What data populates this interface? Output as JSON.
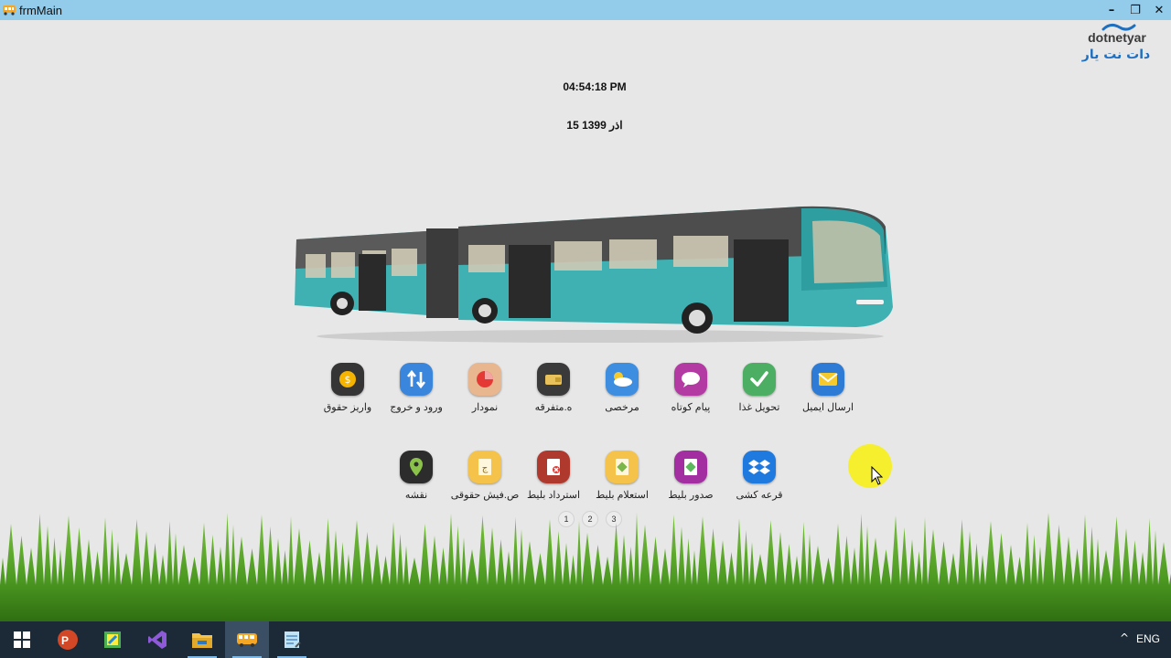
{
  "window": {
    "title": "frmMain",
    "minimize": "–",
    "restore": "❐",
    "close": "✕"
  },
  "brand": {
    "latin": "dotnetyar",
    "persian": "دات نت یار"
  },
  "clock": "04:54:18 PM",
  "date": "15 اذر 1399",
  "row1": [
    {
      "label": "ارسال ایمیل",
      "icon": "email-icon"
    },
    {
      "label": "تحویل غذا",
      "icon": "check-icon"
    },
    {
      "label": "پیام کوتاه",
      "icon": "message-icon"
    },
    {
      "label": "مرخصی",
      "icon": "weather-cloud-icon"
    },
    {
      "label": "ه.متفرقه",
      "icon": "wallet-icon"
    },
    {
      "label": "نمودار",
      "icon": "pie-chart-icon"
    },
    {
      "label": "ورود و خروج",
      "icon": "arrows-updown-icon"
    },
    {
      "label": "واریز حقوق",
      "icon": "coin-icon"
    }
  ],
  "row2": [
    {
      "label": "قرعه کشی",
      "icon": "dropbox-icon"
    },
    {
      "label": "صدور بلیط",
      "icon": "ticket-issue-icon"
    },
    {
      "label": "استعلام بلیط",
      "icon": "ticket-inquiry-icon"
    },
    {
      "label": "استرداد بلیط",
      "icon": "ticket-refund-icon"
    },
    {
      "label": "ص.فیش حقوقی",
      "icon": "payslip-icon"
    },
    {
      "label": "نقشه",
      "icon": "map-pin-icon"
    }
  ],
  "pager": [
    "1",
    "2",
    "3"
  ],
  "taskbar": {
    "apps": [
      "start-icon",
      "powerpoint-icon",
      "paint-icon",
      "visual-studio-icon",
      "file-explorer-icon",
      "bus-app-icon",
      "notepad-icon"
    ],
    "language": "ENG",
    "tray_chevron": "^"
  }
}
